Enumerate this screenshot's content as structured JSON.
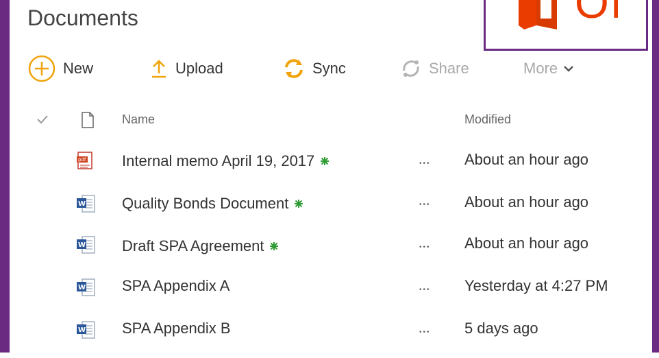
{
  "page": {
    "title": "Documents"
  },
  "logo": {
    "text": "Of",
    "brand_color": "#eb3c00"
  },
  "theme": {
    "accent": "#6a2a82",
    "new_badge_color": "#2e9b34"
  },
  "toolbar": {
    "new_label": "New",
    "upload_label": "Upload",
    "sync_label": "Sync",
    "share_label": "Share",
    "more_label": "More"
  },
  "columns": {
    "name": "Name",
    "modified": "Modified"
  },
  "files": [
    {
      "name": "Internal memo April 19, 2017",
      "modified": "About an hour ago",
      "type": "pdf-icon",
      "is_new": true,
      "more": "..."
    },
    {
      "name": "Quality Bonds Document",
      "modified": "About an hour ago",
      "type": "word-icon",
      "is_new": true,
      "more": "..."
    },
    {
      "name": "Draft SPA Agreement",
      "modified": "About an hour ago",
      "type": "word-icon",
      "is_new": true,
      "more": "..."
    },
    {
      "name": "SPA Appendix A",
      "modified": "Yesterday at 4:27 PM",
      "type": "word-icon",
      "is_new": false,
      "more": "..."
    },
    {
      "name": "SPA Appendix B",
      "modified": "5 days ago",
      "type": "word-icon",
      "is_new": false,
      "more": "..."
    }
  ]
}
